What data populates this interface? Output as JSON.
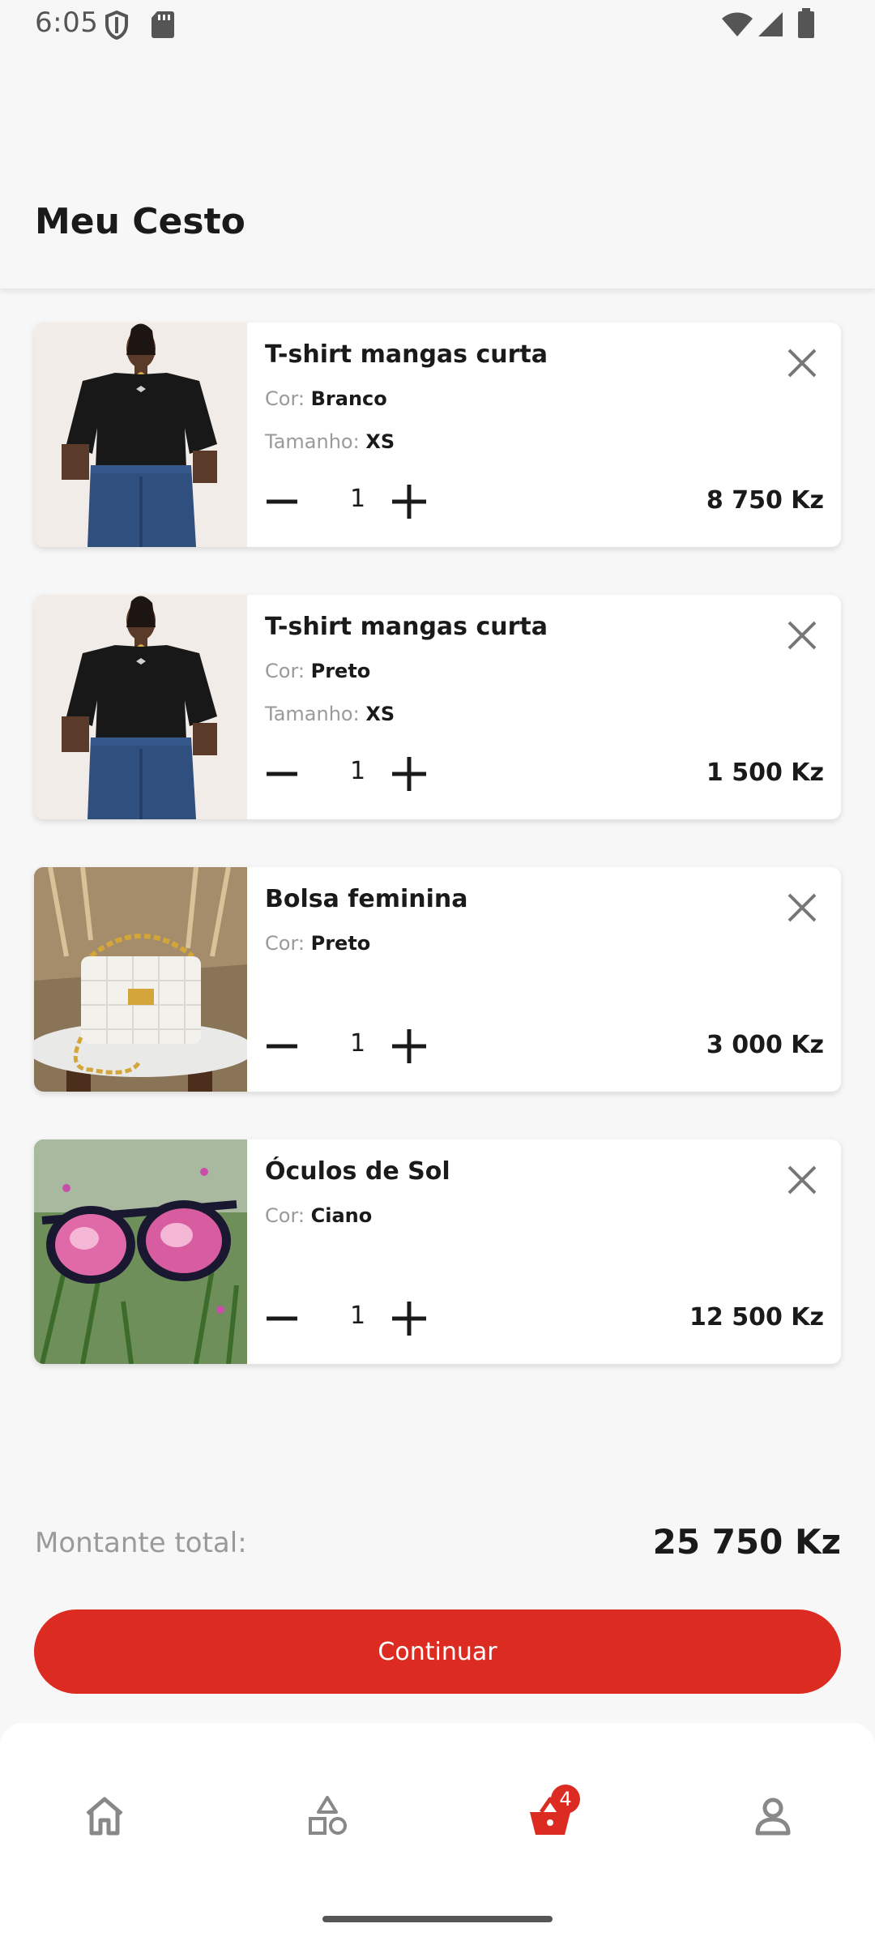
{
  "status_bar": {
    "time": "6:05",
    "icons": [
      "shield-icon",
      "sd-card-icon",
      "wifi-icon",
      "signal-icon",
      "battery-icon"
    ]
  },
  "header": {
    "title": "Meu Cesto"
  },
  "cart_items": [
    {
      "name": "T-shirt mangas curta",
      "color_label": "Cor:",
      "color": "Branco",
      "size_label": "Tamanho:",
      "size": "XS",
      "quantity": "1",
      "price": "8 750 Kz",
      "image": "tshirt-photo"
    },
    {
      "name": "T-shirt mangas curta",
      "color_label": "Cor:",
      "color": "Preto",
      "size_label": "Tamanho:",
      "size": "XS",
      "quantity": "1",
      "price": "1 500 Kz",
      "image": "tshirt-photo"
    },
    {
      "name": "Bolsa feminina",
      "color_label": "Cor:",
      "color": "Preto",
      "quantity": "1",
      "price": "3 000 Kz",
      "image": "handbag-photo"
    },
    {
      "name": "Óculos de Sol",
      "color_label": "Cor:",
      "color": "Ciano",
      "quantity": "1",
      "price": "12 500 Kz",
      "image": "sunglasses-photo"
    }
  ],
  "summary": {
    "total_label": "Montante total:",
    "total_value": "25 750 Kz"
  },
  "actions": {
    "continue_label": "Continuar"
  },
  "bottom_nav": {
    "items": [
      {
        "icon": "home-icon",
        "active": false
      },
      {
        "icon": "categories-icon",
        "active": false
      },
      {
        "icon": "cart-icon",
        "active": true,
        "badge": "4"
      },
      {
        "icon": "profile-icon",
        "active": false
      }
    ]
  },
  "colors": {
    "accent": "#dc2c21",
    "background": "#f7f7f7",
    "text_primary": "#1a1a1a",
    "text_muted": "#9a9a9a",
    "nav_inactive": "#888888"
  }
}
